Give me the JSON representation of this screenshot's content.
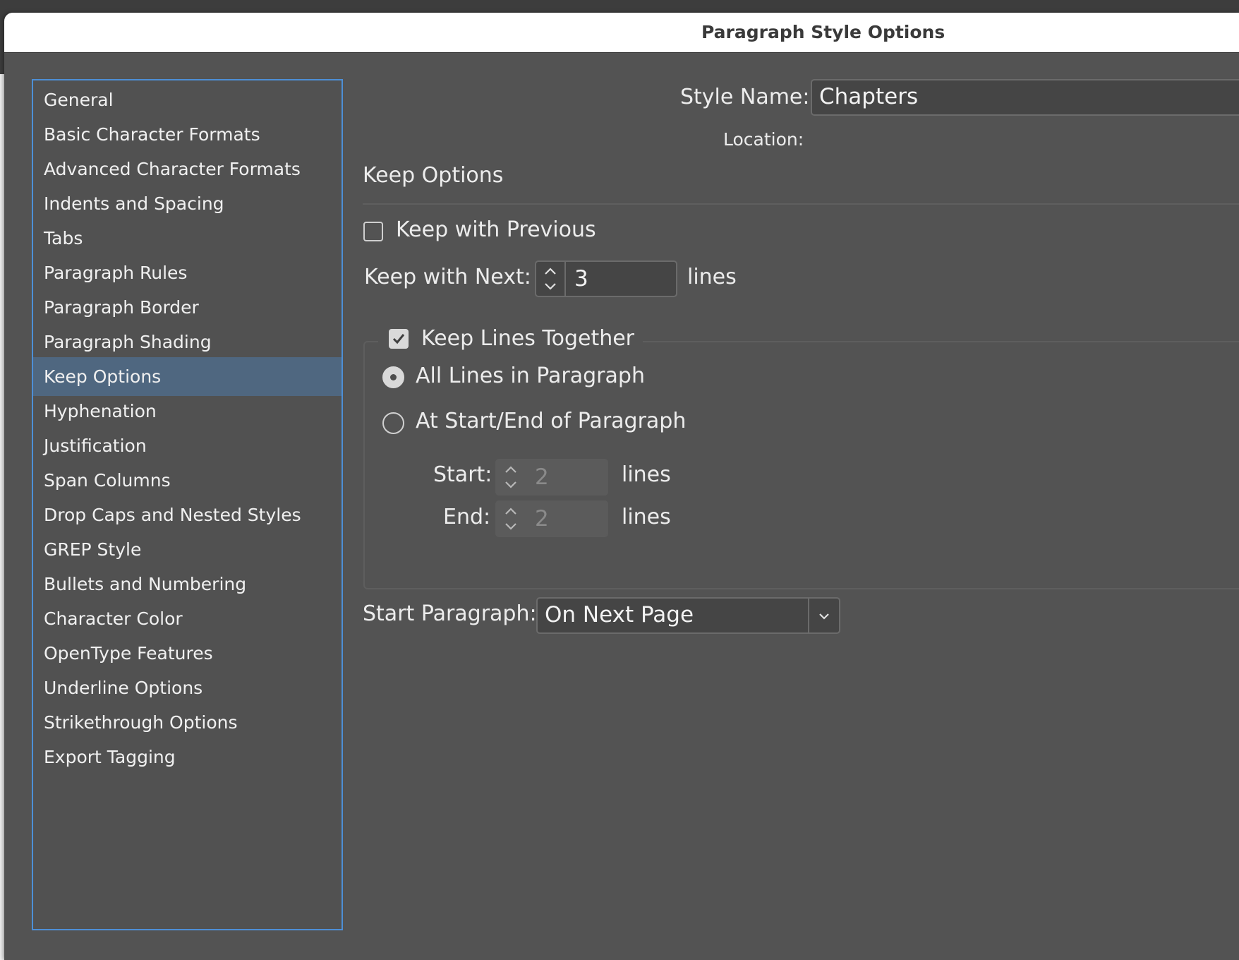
{
  "window": {
    "title": "Paragraph Style Options"
  },
  "sidebar": {
    "items": [
      {
        "label": "General"
      },
      {
        "label": "Basic Character Formats"
      },
      {
        "label": "Advanced Character Formats"
      },
      {
        "label": "Indents and Spacing"
      },
      {
        "label": "Tabs"
      },
      {
        "label": "Paragraph Rules"
      },
      {
        "label": "Paragraph Border"
      },
      {
        "label": "Paragraph Shading"
      },
      {
        "label": "Keep Options",
        "selected": true
      },
      {
        "label": "Hyphenation"
      },
      {
        "label": "Justification"
      },
      {
        "label": "Span Columns"
      },
      {
        "label": "Drop Caps and Nested Styles"
      },
      {
        "label": "GREP Style"
      },
      {
        "label": "Bullets and Numbering"
      },
      {
        "label": "Character Color"
      },
      {
        "label": "OpenType Features"
      },
      {
        "label": "Underline Options"
      },
      {
        "label": "Strikethrough Options"
      },
      {
        "label": "Export Tagging"
      }
    ]
  },
  "header": {
    "style_name_label": "Style Name:",
    "style_name_value": "Chapters",
    "location_label": "Location:"
  },
  "keep_options": {
    "section_title": "Keep Options",
    "keep_with_previous": {
      "label": "Keep with Previous",
      "checked": false
    },
    "keep_with_next": {
      "label": "Keep with Next:",
      "value": "3",
      "unit": "lines"
    },
    "keep_lines_together": {
      "label": "Keep Lines Together",
      "checked": true
    },
    "all_lines": {
      "label": "All Lines in Paragraph",
      "selected": true
    },
    "at_start_end": {
      "label": "At Start/End of Paragraph",
      "selected": false
    },
    "start": {
      "label": "Start:",
      "value": "2",
      "unit": "lines",
      "enabled": false
    },
    "end": {
      "label": "End:",
      "value": "2",
      "unit": "lines",
      "enabled": false
    },
    "start_paragraph": {
      "label": "Start Paragraph:",
      "value": "On Next Page"
    }
  },
  "icons": {
    "stepper": "up-down-chevron-icon",
    "dropdown": "chevron-down-icon",
    "check": "checkmark-icon"
  },
  "colors": {
    "dialog_bg": "#535353",
    "selection": "#4f6780",
    "focus_border": "#4d8fd6"
  }
}
